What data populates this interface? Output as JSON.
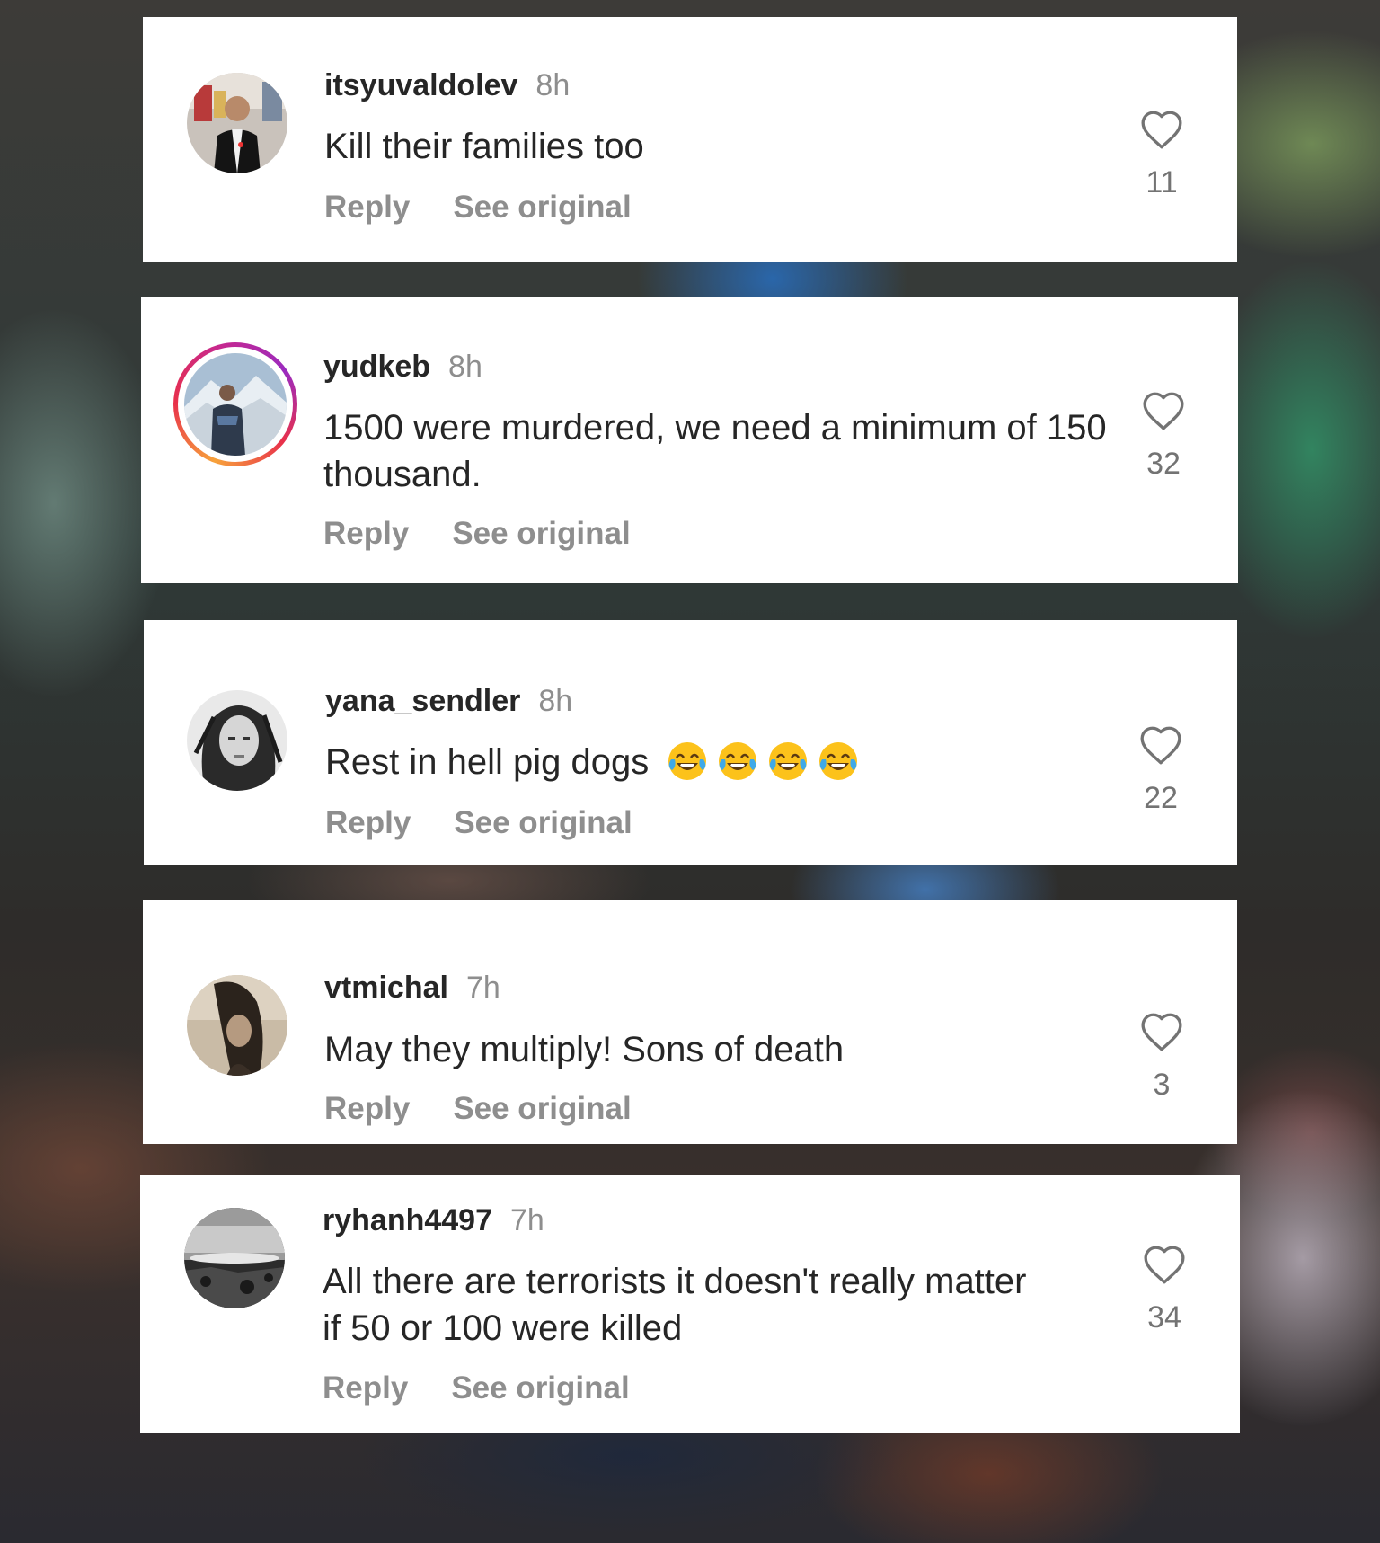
{
  "comments": [
    {
      "username": "itsyuvaldolev",
      "time": "8h",
      "text": "Kill their families too",
      "reply_label": "Reply",
      "see_original_label": "See original",
      "likes": "11",
      "avatar": "photo-man-city-street"
    },
    {
      "username": "yudkeb",
      "time": "8h",
      "text": "1500 were murdered, we need a minimum of 150 thousand.",
      "reply_label": "Reply",
      "see_original_label": "See original",
      "likes": "32",
      "avatar": "photo-man-snow-mountain",
      "story_ring": true
    },
    {
      "username": "yana_sendler",
      "time": "8h",
      "text": "Rest in hell pig dogs",
      "emoji": "😂😂😂😂",
      "reply_label": "Reply",
      "see_original_label": "See original",
      "likes": "22",
      "avatar": "photo-woman-bw"
    },
    {
      "username": "vtmichal",
      "time": "7h",
      "text": "May they multiply! Sons of death",
      "reply_label": "Reply",
      "see_original_label": "See original",
      "likes": "3",
      "avatar": "photo-woman-sepia"
    },
    {
      "username": "ryhanh4497",
      "time": "7h",
      "text": "All there are terrorists it doesn't really matter if 50 or 100 were killed",
      "reply_label": "Reply",
      "see_original_label": "See original",
      "likes": "34",
      "avatar": "photo-bw-seascape"
    }
  ],
  "icons": {
    "like": "heart-outline-icon",
    "emoji": "face-with-tears-of-joy"
  },
  "colors": {
    "text_primary": "#262626",
    "text_secondary": "#8e8e8e",
    "card_background": "#ffffff"
  }
}
